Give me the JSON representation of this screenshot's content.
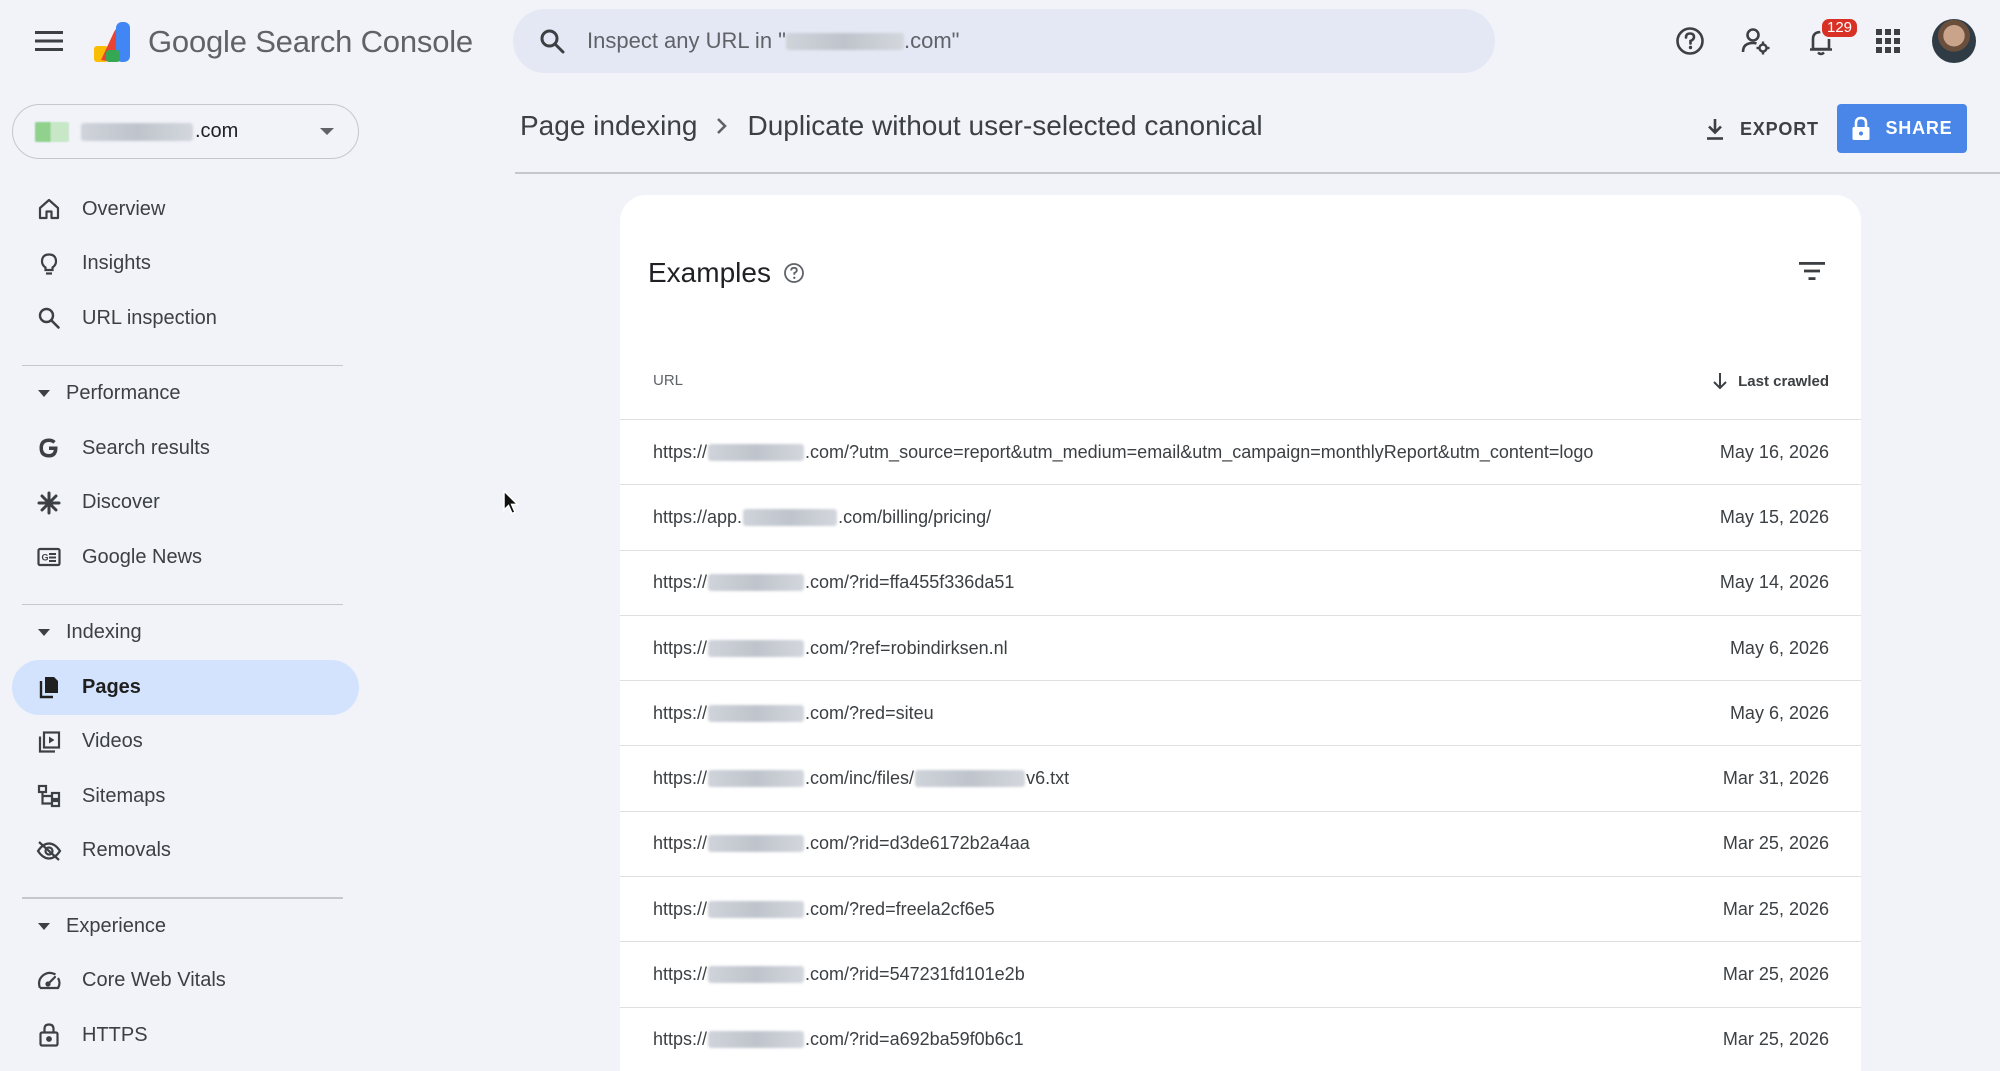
{
  "app": {
    "title_google": "Google",
    "title_product": "Search Console"
  },
  "search": {
    "placeholder_prefix": "Inspect any URL in \"",
    "placeholder_suffix": ".com\""
  },
  "topbar": {
    "notification_count": "129",
    "icons": [
      "help-icon",
      "manage-users-icon",
      "notifications-icon",
      "apps-icon",
      "avatar"
    ]
  },
  "property": {
    "suffix": ".com"
  },
  "sidebar": {
    "items_top": [
      {
        "label": "Overview",
        "icon": "home-icon"
      },
      {
        "label": "Insights",
        "icon": "lightbulb-icon"
      },
      {
        "label": "URL inspection",
        "icon": "search-icon"
      }
    ],
    "performance": {
      "label": "Performance",
      "items": [
        {
          "label": "Search results",
          "icon": "google-g-icon"
        },
        {
          "label": "Discover",
          "icon": "asterisk-icon"
        },
        {
          "label": "Google News",
          "icon": "news-icon"
        }
      ]
    },
    "indexing": {
      "label": "Indexing",
      "items": [
        {
          "label": "Pages",
          "icon": "pages-icon",
          "active": true
        },
        {
          "label": "Videos",
          "icon": "video-library-icon"
        },
        {
          "label": "Sitemaps",
          "icon": "sitemap-icon"
        },
        {
          "label": "Removals",
          "icon": "eye-off-icon"
        }
      ]
    },
    "experience": {
      "label": "Experience",
      "items": [
        {
          "label": "Core Web Vitals",
          "icon": "speed-icon"
        },
        {
          "label": "HTTPS",
          "icon": "lock-icon"
        }
      ]
    }
  },
  "header": {
    "breadcrumb_root": "Page indexing",
    "breadcrumb_current": "Duplicate without user-selected canonical",
    "export_label": "EXPORT",
    "share_label": "SHARE"
  },
  "examples": {
    "title": "Examples",
    "col_url": "URL",
    "col_date": "Last crawled",
    "rows": [
      {
        "prefix": "https://",
        "host": "dom",
        "path": ".com/?utm_source=report&utm_medium=email&utm_campaign=monthlyReport&utm_content=logo",
        "date": "May 16, 2026"
      },
      {
        "prefix": "https://app.",
        "host": "dom",
        "path": ".com/billing/pricing/",
        "date": "May 15, 2026"
      },
      {
        "prefix": "https://",
        "host": "dom",
        "path": ".com/?rid=ffa455f336da51",
        "date": "May 14, 2026"
      },
      {
        "prefix": "https://",
        "host": "dom",
        "path": ".com/?ref=robindirksen.nl",
        "date": "May 6, 2026"
      },
      {
        "prefix": "https://",
        "host": "dom",
        "path": ".com/?red=siteu",
        "date": "May 6, 2026"
      },
      {
        "prefix": "https://",
        "host": "dom",
        "path": ".com/inc/files/",
        "file": "v6.txt",
        "date": "Mar 31, 2026"
      },
      {
        "prefix": "https://",
        "host": "dom",
        "path": ".com/?rid=d3de6172b2a4aa",
        "date": "Mar 25, 2026"
      },
      {
        "prefix": "https://",
        "host": "dom",
        "path": ".com/?red=freela2cf6e5",
        "date": "Mar 25, 2026"
      },
      {
        "prefix": "https://",
        "host": "dom",
        "path": ".com/?rid=547231fd101e2b",
        "date": "Mar 25, 2026"
      },
      {
        "prefix": "https://",
        "host": "dom",
        "path": ".com/?rid=a692ba59f0b6c1",
        "date": "Mar 25, 2026"
      }
    ]
  },
  "colors": {
    "background": "#f1f3f9",
    "search_bg": "#e3e8f4",
    "active_nav": "#d3e3fd",
    "share_button": "#4a86e8",
    "badge": "#d93025"
  }
}
